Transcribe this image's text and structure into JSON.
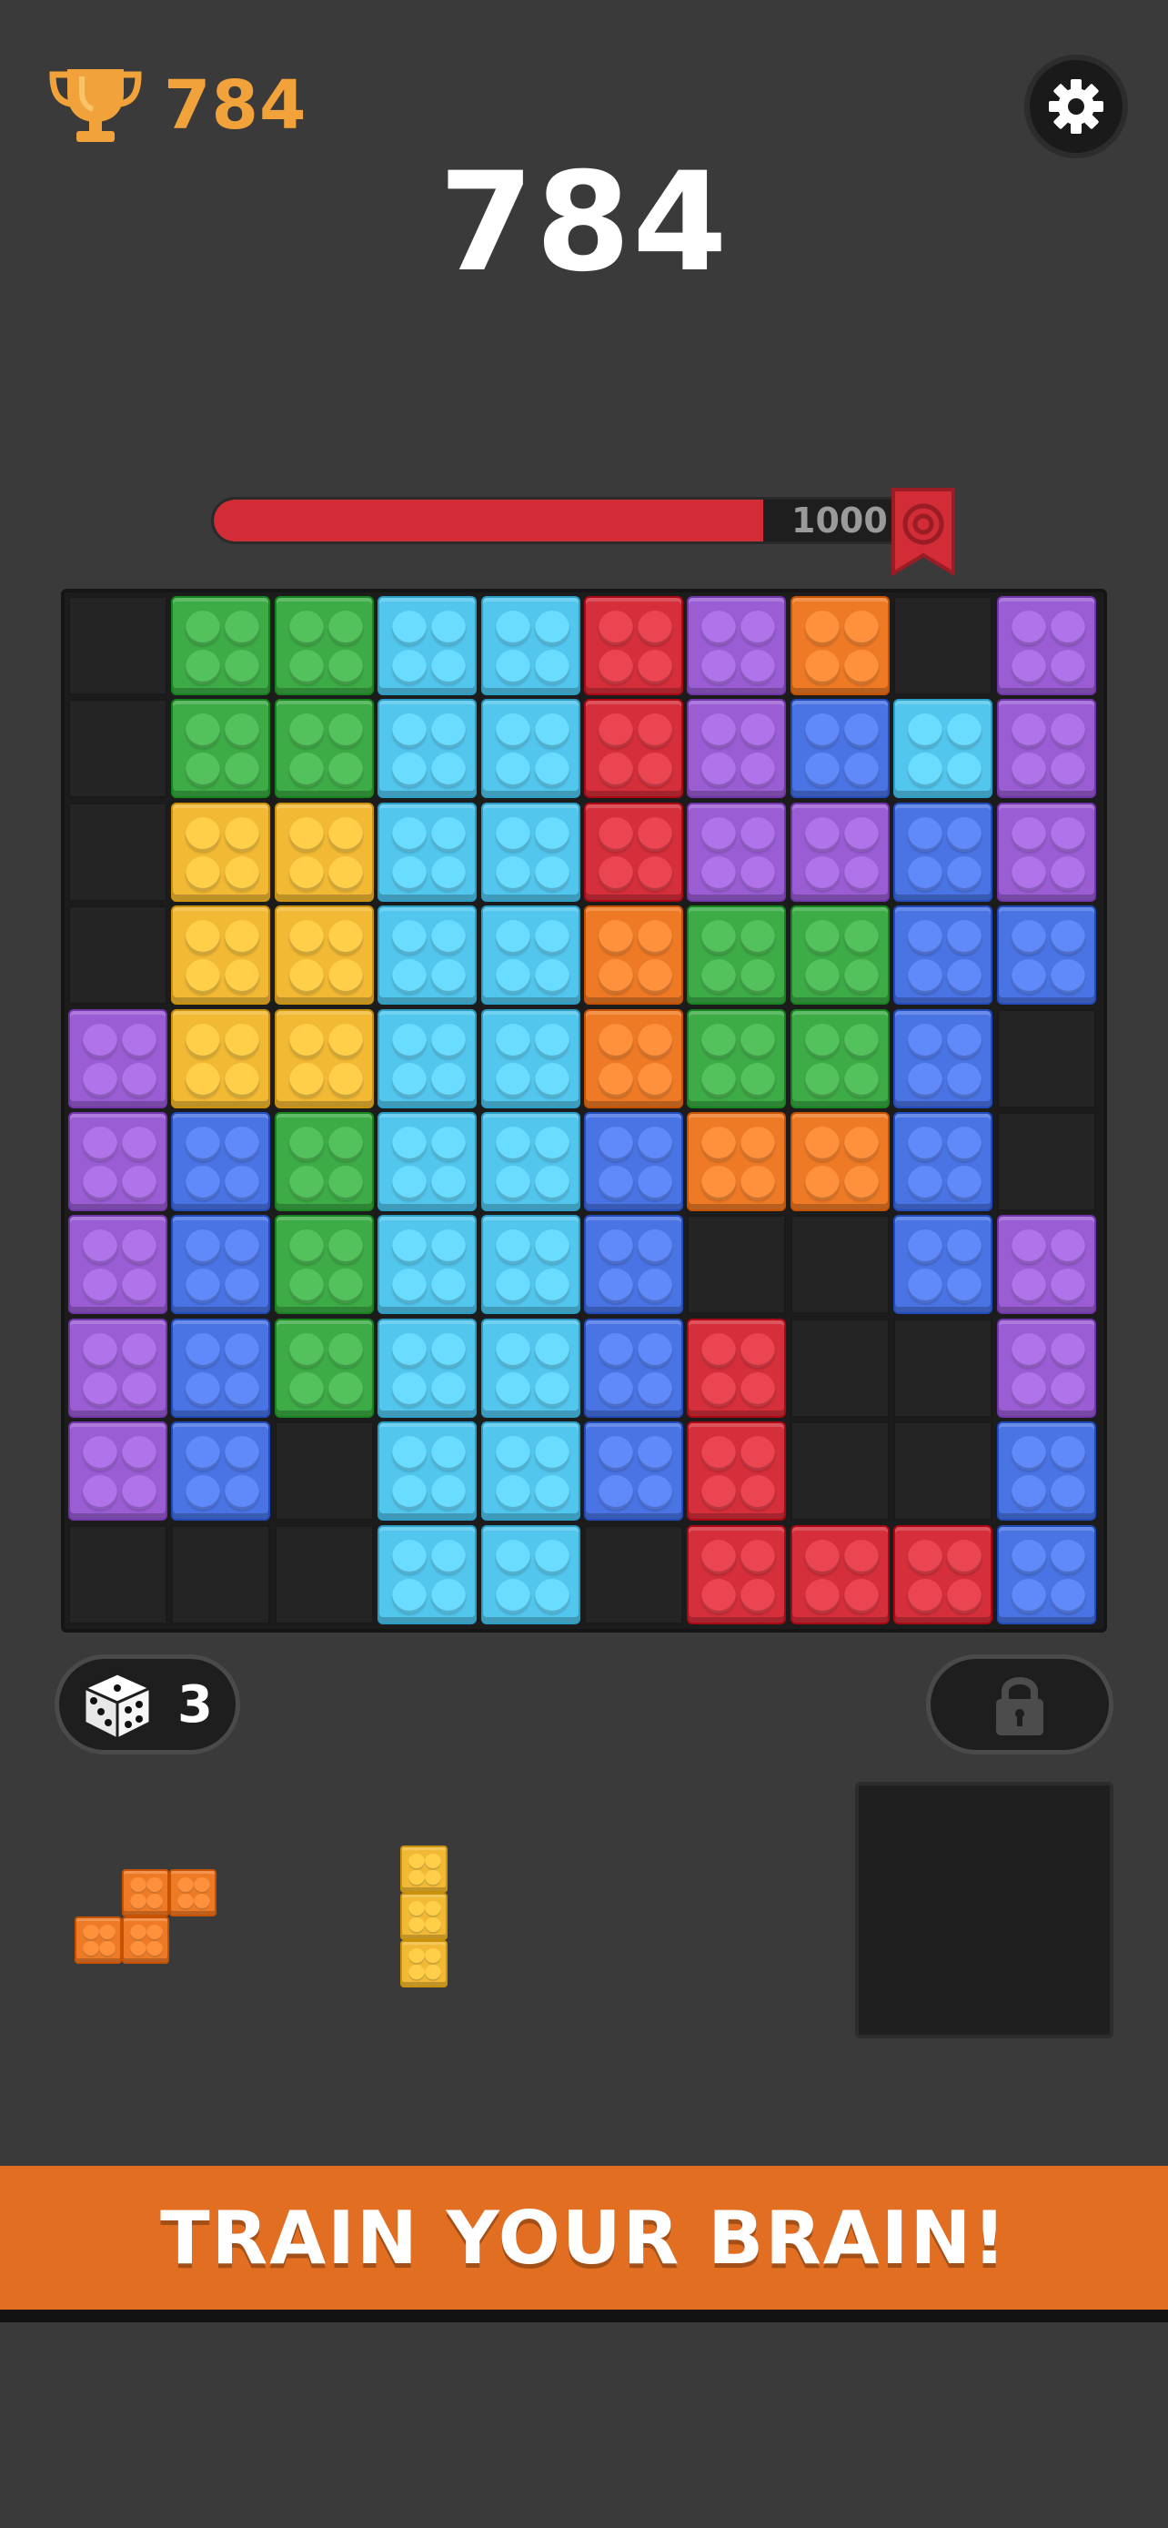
{
  "header": {
    "best_score": "784",
    "score": "784",
    "trophy_icon": "trophy-icon",
    "settings_icon": "gear-icon"
  },
  "progress": {
    "value": 784,
    "target": 1000,
    "target_label": "1000",
    "flag_icon": "target-flag-icon"
  },
  "colors": {
    "green": "#3dab46",
    "cyan": "#53c6ee",
    "red": "#d42f3a",
    "purple": "#9a5dd4",
    "orange": "#ee7a26",
    "blue": "#4a74e4",
    "yellow": "#f2b934"
  },
  "board": {
    "rows": [
      [
        "empty",
        "green",
        "green",
        "cyan",
        "cyan",
        "red",
        "purple",
        "orange",
        "empty",
        "purple"
      ],
      [
        "empty",
        "green",
        "green",
        "cyan",
        "cyan",
        "red",
        "purple",
        "blue",
        "cyan",
        "purple"
      ],
      [
        "empty",
        "yellow",
        "yellow",
        "cyan",
        "cyan",
        "red",
        "purple",
        "purple",
        "blue",
        "purple"
      ],
      [
        "empty",
        "yellow",
        "yellow",
        "cyan",
        "cyan",
        "orange",
        "green",
        "green",
        "blue",
        "blue"
      ],
      [
        "purple",
        "yellow",
        "yellow",
        "cyan",
        "cyan",
        "orange",
        "green",
        "green",
        "blue",
        "empty"
      ],
      [
        "purple",
        "blue",
        "green",
        "cyan",
        "cyan",
        "blue",
        "orange",
        "orange",
        "blue",
        "empty"
      ],
      [
        "purple",
        "blue",
        "green",
        "cyan",
        "cyan",
        "blue",
        "empty",
        "empty",
        "blue",
        "purple"
      ],
      [
        "purple",
        "blue",
        "green",
        "cyan",
        "cyan",
        "blue",
        "red",
        "empty",
        "empty",
        "purple"
      ],
      [
        "purple",
        "blue",
        "empty",
        "cyan",
        "cyan",
        "blue",
        "red",
        "empty",
        "empty",
        "blue"
      ],
      [
        "empty",
        "empty",
        "empty",
        "cyan",
        "cyan",
        "empty",
        "red",
        "red",
        "red",
        "blue"
      ]
    ]
  },
  "controls": {
    "dice_count": "3",
    "dice_icon": "dice-icon",
    "lock_icon": "lock-icon"
  },
  "pieces": [
    {
      "color": "orange",
      "cells": [
        [
          0,
          1
        ],
        [
          0,
          2
        ],
        [
          1,
          0
        ],
        [
          1,
          1
        ]
      ]
    },
    {
      "color": "yellow",
      "cells": [
        [
          0,
          0
        ],
        [
          1,
          0
        ],
        [
          2,
          0
        ]
      ]
    }
  ],
  "banner": {
    "text": "TRAIN YOUR BRAIN!"
  }
}
